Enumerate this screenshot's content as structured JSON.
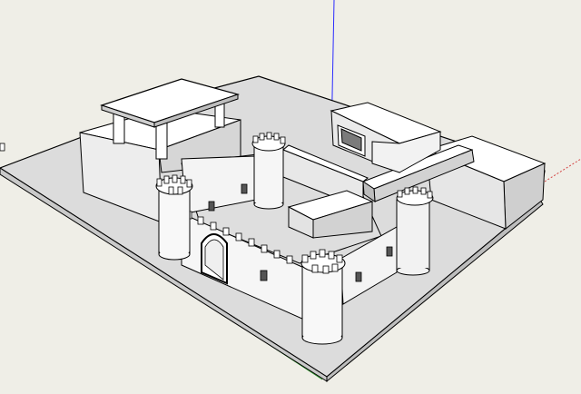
{
  "app": {
    "background_color": "#efeee7",
    "surface_color": "#dcdcdc",
    "wall_face_light": "#ffffff",
    "wall_face_mid": "#e6e6e6",
    "wall_face_dark": "#cfcfcf",
    "edge_color": "#000000"
  },
  "axes": {
    "blue_axis_color": "#2b2bff",
    "red_axis_color": "#d44545",
    "green_axis_color": "#2fa02f"
  },
  "scene": {
    "model": "castle",
    "parts": [
      "ground-plane",
      "gatehouse",
      "courtyard-walls",
      "round-towers",
      "pavilion-roof",
      "side-building"
    ]
  }
}
